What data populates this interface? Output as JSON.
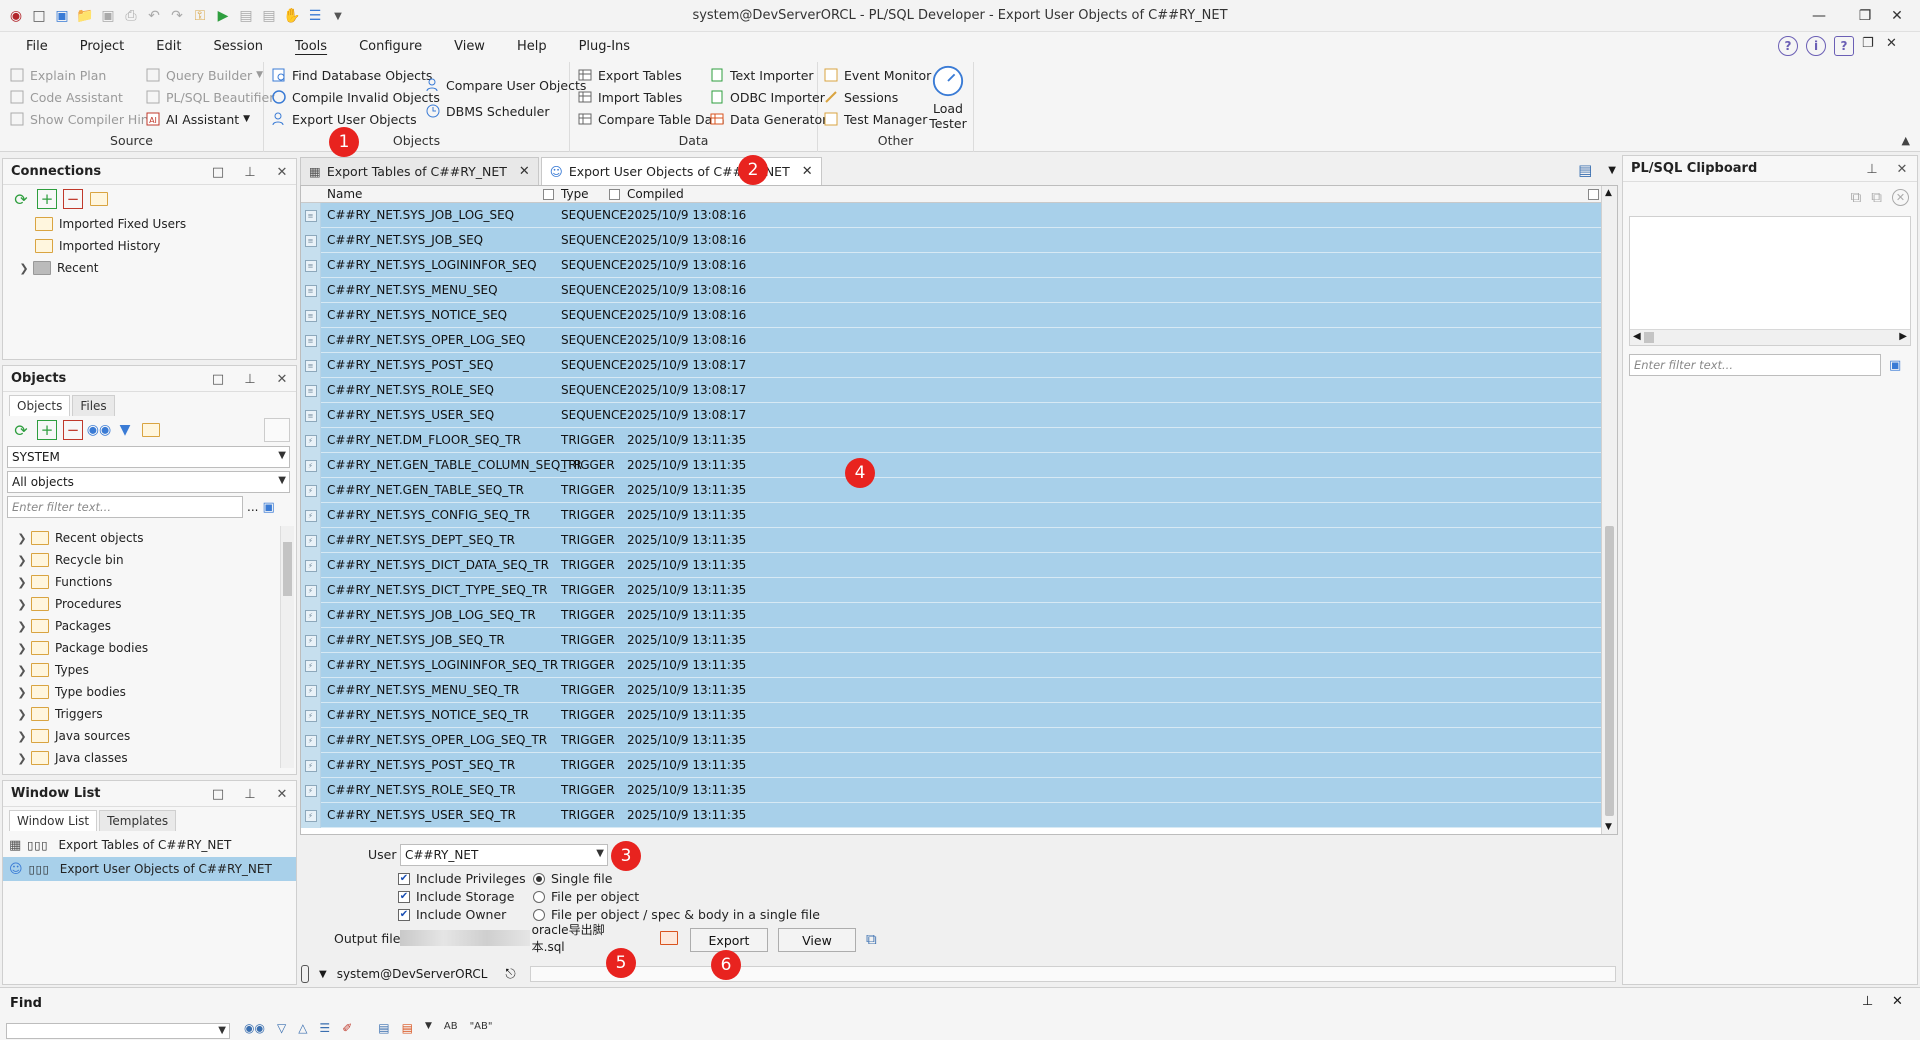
{
  "window": {
    "title": "system@DevServerORCL - PL/SQL Developer - Export User Objects of C##RY_NET"
  },
  "menu": [
    "File",
    "Project",
    "Edit",
    "Session",
    "Tools",
    "Configure",
    "View",
    "Help",
    "Plug-Ins"
  ],
  "ribbon": {
    "source": {
      "caption": "Source",
      "explain_plan": "Explain Plan",
      "code_assistant": "Code Assistant",
      "show_compiler_hints": "Show Compiler Hints",
      "query_builder": "Query Builder",
      "plsql_beautifier": "PL/SQL Beautifier",
      "ai_assistant": "AI Assistant"
    },
    "objects": {
      "caption": "Objects",
      "find_db_objects": "Find Database Objects",
      "compile_invalid": "Compile Invalid Objects",
      "export_user_objects": "Export User Objects",
      "compare_user_objects": "Compare User Objects",
      "dbms_scheduler": "DBMS Scheduler"
    },
    "data": {
      "caption": "Data",
      "export_tables": "Export Tables",
      "import_tables": "Import Tables",
      "compare_table_data": "Compare Table Data",
      "text_importer": "Text Importer",
      "odbc_importer": "ODBC Importer",
      "data_generator": "Data Generator"
    },
    "other": {
      "caption": "Other",
      "event_monitor": "Event Monitor",
      "sessions": "Sessions",
      "test_manager": "Test Manager",
      "load_tester_1": "Load",
      "load_tester_2": "Tester"
    }
  },
  "connections": {
    "title": "Connections",
    "items": [
      "Imported Fixed Users",
      "Imported History",
      "Recent"
    ]
  },
  "objects_panel": {
    "title": "Objects",
    "tabs": [
      "Objects",
      "Files"
    ],
    "user": "SYSTEM",
    "filter_type": "All objects",
    "filter_placeholder": "Enter filter text...",
    "dots": "...",
    "items": [
      "Recent objects",
      "Recycle bin",
      "Functions",
      "Procedures",
      "Packages",
      "Package bodies",
      "Types",
      "Type bodies",
      "Triggers",
      "Java sources",
      "Java classes"
    ]
  },
  "window_list": {
    "title": "Window List",
    "tabs": [
      "Window List",
      "Templates"
    ],
    "items": [
      "Export Tables of C##RY_NET",
      "Export User Objects of C##RY_NET"
    ]
  },
  "doc_tabs": [
    "Export Tables of C##RY_NET",
    "Export User Objects of C##RY_NET"
  ],
  "grid": {
    "headers": [
      "Name",
      "Type",
      "Compiled"
    ],
    "rows": [
      [
        "C##RY_NET.SYS_JOB_LOG_SEQ",
        "SEQUENCE",
        "2025/10/9 13:08:16"
      ],
      [
        "C##RY_NET.SYS_JOB_SEQ",
        "SEQUENCE",
        "2025/10/9 13:08:16"
      ],
      [
        "C##RY_NET.SYS_LOGININFOR_SEQ",
        "SEQUENCE",
        "2025/10/9 13:08:16"
      ],
      [
        "C##RY_NET.SYS_MENU_SEQ",
        "SEQUENCE",
        "2025/10/9 13:08:16"
      ],
      [
        "C##RY_NET.SYS_NOTICE_SEQ",
        "SEQUENCE",
        "2025/10/9 13:08:16"
      ],
      [
        "C##RY_NET.SYS_OPER_LOG_SEQ",
        "SEQUENCE",
        "2025/10/9 13:08:16"
      ],
      [
        "C##RY_NET.SYS_POST_SEQ",
        "SEQUENCE",
        "2025/10/9 13:08:17"
      ],
      [
        "C##RY_NET.SYS_ROLE_SEQ",
        "SEQUENCE",
        "2025/10/9 13:08:17"
      ],
      [
        "C##RY_NET.SYS_USER_SEQ",
        "SEQUENCE",
        "2025/10/9 13:08:17"
      ],
      [
        "C##RY_NET.DM_FLOOR_SEQ_TR",
        "TRIGGER",
        "2025/10/9 13:11:35"
      ],
      [
        "C##RY_NET.GEN_TABLE_COLUMN_SEQ_TR",
        "TRIGGER",
        "2025/10/9 13:11:35"
      ],
      [
        "C##RY_NET.GEN_TABLE_SEQ_TR",
        "TRIGGER",
        "2025/10/9 13:11:35"
      ],
      [
        "C##RY_NET.SYS_CONFIG_SEQ_TR",
        "TRIGGER",
        "2025/10/9 13:11:35"
      ],
      [
        "C##RY_NET.SYS_DEPT_SEQ_TR",
        "TRIGGER",
        "2025/10/9 13:11:35"
      ],
      [
        "C##RY_NET.SYS_DICT_DATA_SEQ_TR",
        "TRIGGER",
        "2025/10/9 13:11:35"
      ],
      [
        "C##RY_NET.SYS_DICT_TYPE_SEQ_TR",
        "TRIGGER",
        "2025/10/9 13:11:35"
      ],
      [
        "C##RY_NET.SYS_JOB_LOG_SEQ_TR",
        "TRIGGER",
        "2025/10/9 13:11:35"
      ],
      [
        "C##RY_NET.SYS_JOB_SEQ_TR",
        "TRIGGER",
        "2025/10/9 13:11:35"
      ],
      [
        "C##RY_NET.SYS_LOGININFOR_SEQ_TR",
        "TRIGGER",
        "2025/10/9 13:11:35"
      ],
      [
        "C##RY_NET.SYS_MENU_SEQ_TR",
        "TRIGGER",
        "2025/10/9 13:11:35"
      ],
      [
        "C##RY_NET.SYS_NOTICE_SEQ_TR",
        "TRIGGER",
        "2025/10/9 13:11:35"
      ],
      [
        "C##RY_NET.SYS_OPER_LOG_SEQ_TR",
        "TRIGGER",
        "2025/10/9 13:11:35"
      ],
      [
        "C##RY_NET.SYS_POST_SEQ_TR",
        "TRIGGER",
        "2025/10/9 13:11:35"
      ],
      [
        "C##RY_NET.SYS_ROLE_SEQ_TR",
        "TRIGGER",
        "2025/10/9 13:11:35"
      ],
      [
        "C##RY_NET.SYS_USER_SEQ_TR",
        "TRIGGER",
        "2025/10/9 13:11:35"
      ]
    ]
  },
  "form": {
    "user_label": "User",
    "user_value": "C##RY_NET",
    "include_privileges": "Include Privileges",
    "include_storage": "Include Storage",
    "include_owner": "Include Owner",
    "single_file": "Single file",
    "file_per_object": "File per object",
    "file_per_object_spec": "File per object / spec & body in a single file",
    "output_file_label": "Output file",
    "output_file_value": "oracle导出脚本.sql",
    "export_button": "Export",
    "view_button": "View"
  },
  "status": {
    "connection": "system@DevServerORCL"
  },
  "clipboard": {
    "title": "PL/SQL Clipboard",
    "filter_placeholder": "Enter filter text..."
  },
  "find": {
    "title": "Find",
    "ab1": "AB",
    "ab2": "\"AB\""
  },
  "badges": [
    "1",
    "2",
    "3",
    "4",
    "5",
    "6"
  ],
  "colors": {
    "selection": "#a8d0ea",
    "badge": "#e8231f"
  }
}
